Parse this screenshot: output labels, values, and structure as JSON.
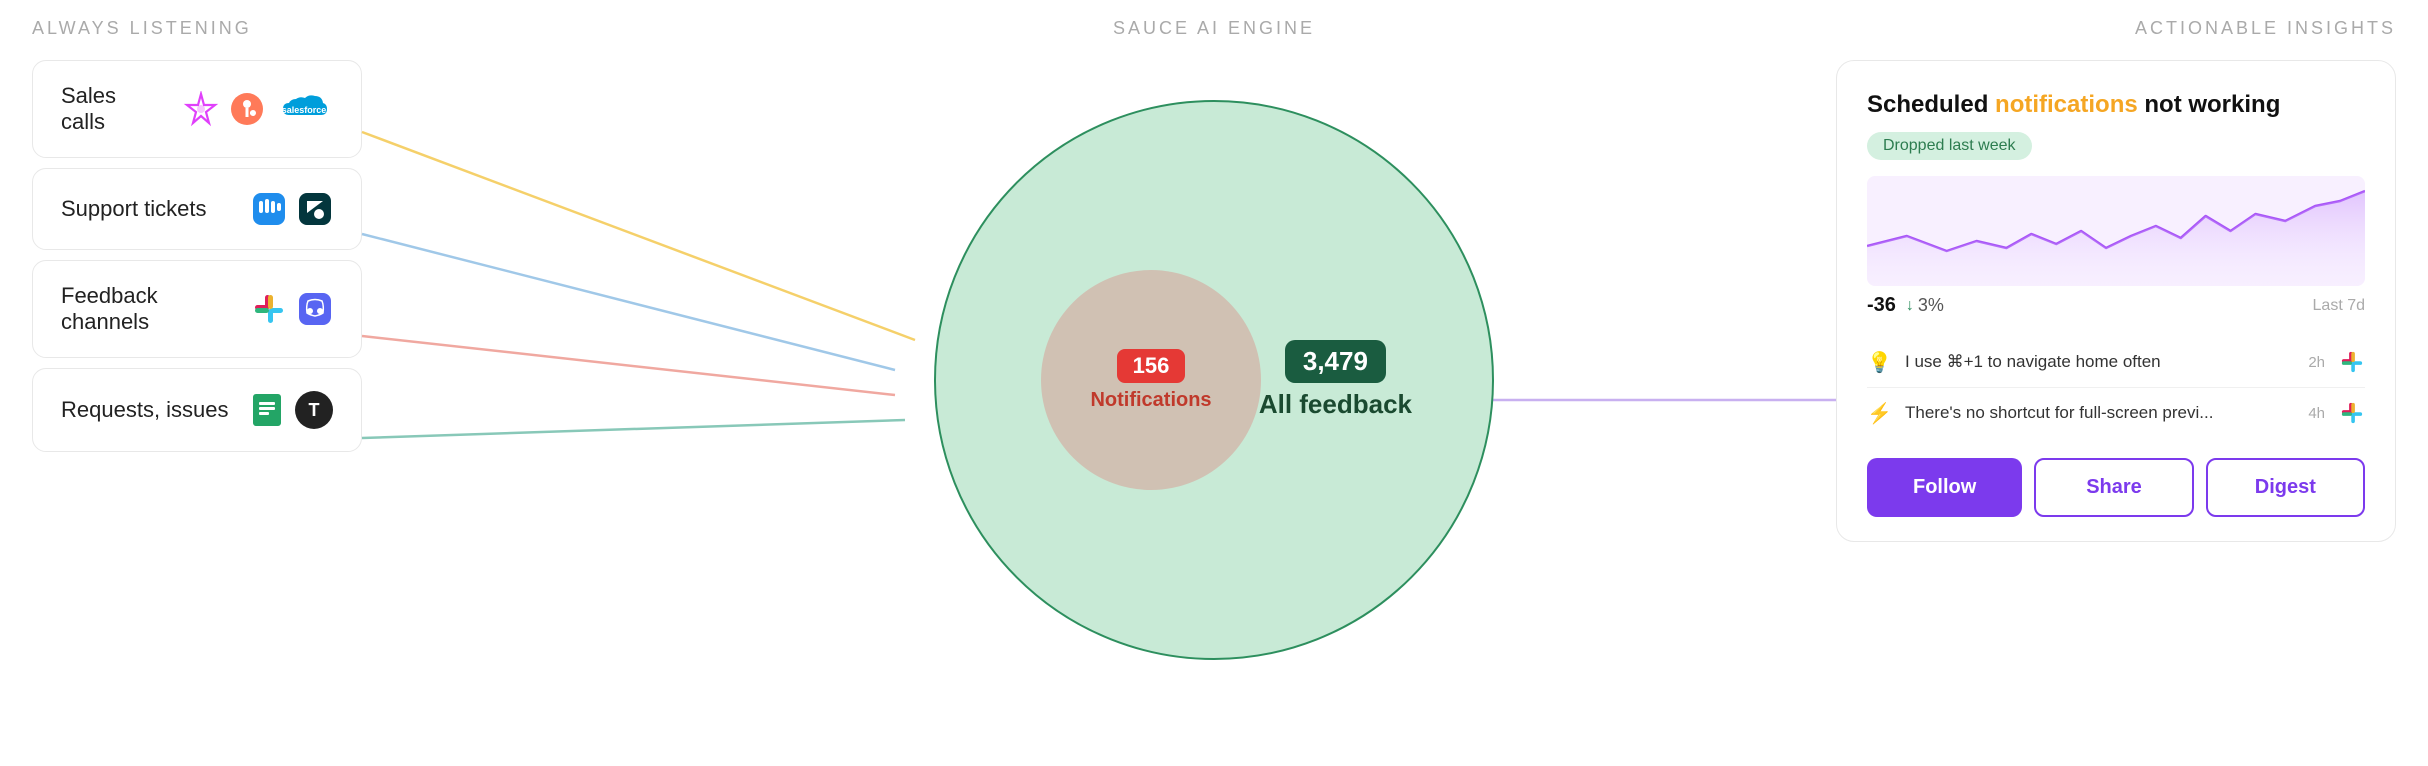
{
  "header": {
    "left_label": "ALWAYS LISTENING",
    "center_label": "SAUCE AI ENGINE",
    "right_label": "ACTIONABLE INSIGHTS"
  },
  "sources": [
    {
      "id": "sales-calls",
      "label": "Sales calls",
      "icons": [
        "astro",
        "hubspot",
        "salesforce"
      ]
    },
    {
      "id": "support-tickets",
      "label": "Support tickets",
      "icons": [
        "intercom",
        "zendesk"
      ]
    },
    {
      "id": "feedback-channels",
      "label": "Feedback channels",
      "icons": [
        "slack",
        "discord"
      ]
    },
    {
      "id": "requests-issues",
      "label": "Requests, issues",
      "icons": [
        "sheets",
        "t"
      ]
    }
  ],
  "center": {
    "all_feedback_count": "3,479",
    "all_feedback_label": "All feedback",
    "notifications_count": "156",
    "notifications_label": "Notifications"
  },
  "card": {
    "title_prefix": "Scheduled ",
    "title_highlight": "notifications",
    "title_suffix": " not working",
    "dropped_badge": "Dropped last week",
    "stat_number": "-36",
    "stat_arrow": "↓",
    "stat_percent": "3%",
    "last_period": "Last 7d",
    "feed_items": [
      {
        "icon": "💡",
        "text": "I use ⌘+1 to navigate home often",
        "time": "2h",
        "source": "slack"
      },
      {
        "icon": "⚡",
        "text": "There's no shortcut for full-screen previ...",
        "time": "4h",
        "source": "slack"
      }
    ],
    "buttons": [
      {
        "id": "follow",
        "label": "Follow",
        "style": "primary"
      },
      {
        "id": "share",
        "label": "Share",
        "style": "outline"
      },
      {
        "id": "digest",
        "label": "Digest",
        "style": "outline"
      }
    ]
  },
  "colors": {
    "accent_purple": "#7c3aed",
    "accent_green": "#1a5c40",
    "accent_orange": "#f5a623",
    "accent_red": "#e53935",
    "big_circle_fill": "#c8ead6",
    "big_circle_border": "#2d8f5e",
    "small_circle_fill": "rgba(230,100,100,0.28)",
    "dropped_badge_bg": "#d4f0e0",
    "dropped_badge_text": "#2d7d50"
  }
}
